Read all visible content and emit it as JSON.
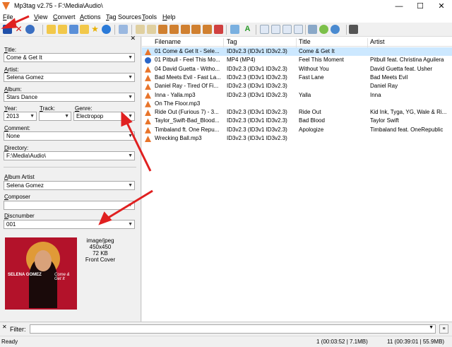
{
  "window": {
    "title": "Mp3tag v2.75  -  F:\\Media\\Audio\\",
    "minimize": "—",
    "maximize": "☐",
    "close": "✕"
  },
  "menu": [
    "File",
    "View",
    "Convert",
    "Actions",
    "Tag Sources",
    "Tools",
    "Help"
  ],
  "panel": {
    "close": "✕",
    "title_label": "Title:",
    "title_value": "Come & Get It",
    "artist_label": "Artist:",
    "artist_value": "Selena Gomez",
    "album_label": "Album:",
    "album_value": "Stars Dance",
    "year_label": "Year:",
    "year_value": "2013",
    "track_label": "Track:",
    "track_value": "",
    "genre_label": "Genre:",
    "genre_value": "Electropop",
    "comment_label": "Comment:",
    "comment_value": "None",
    "directory_label": "Directory:",
    "directory_value": "F:\\Media\\Audio\\",
    "albumartist_label": "Album Artist",
    "albumartist_value": "Selena Gomez",
    "composer_label": "Composer",
    "composer_value": "",
    "discnumber_label": "Discnumber",
    "discnumber_value": "001",
    "cover": {
      "type": "image/jpeg",
      "dims": "450x450",
      "size": "72 KB",
      "kind": "Front Cover",
      "text_left": "SELENA GOMEZ",
      "text_right": "Come & Get It"
    }
  },
  "grid": {
    "columns": [
      "Filename",
      "Tag",
      "Title",
      "Artist"
    ],
    "rows": [
      {
        "filename": "01 Come & Get It - Sele...",
        "tag": "ID3v2.3 (ID3v1 ID3v2.3)",
        "title": "Come & Get It",
        "artist": "",
        "icon": "vlc-icon"
      },
      {
        "filename": "01 Pitbull - Feel This Mo...",
        "tag": "MP4 (MP4)",
        "title": "Feel This Moment",
        "artist": "Pitbull feat. Christina Aguilera",
        "icon": "media-icon"
      },
      {
        "filename": "04 David Guetta - Witho...",
        "tag": "ID3v2.3 (ID3v1 ID3v2.3)",
        "title": "Without You",
        "artist": "David Guetta feat. Usher",
        "icon": "vlc-icon"
      },
      {
        "filename": "Bad Meets Evil - Fast La...",
        "tag": "ID3v2.3 (ID3v1 ID3v2.3)",
        "title": "Fast Lane",
        "artist": "Bad Meets Evil",
        "icon": "vlc-icon"
      },
      {
        "filename": "Daniel Ray - Tired Of Fi...",
        "tag": "ID3v2.3 (ID3v1 ID3v2.3)",
        "title": "",
        "artist": "Daniel Ray",
        "icon": "vlc-icon"
      },
      {
        "filename": "Inna - Yalla.mp3",
        "tag": "ID3v2.3 (ID3v1 ID3v2.3)",
        "title": "Yalla",
        "artist": "Inna",
        "icon": "vlc-icon"
      },
      {
        "filename": "On The Floor.mp3",
        "tag": "",
        "title": "",
        "artist": "",
        "icon": "vlc-icon"
      },
      {
        "filename": "Ride Out (Furious 7) - 3...",
        "tag": "ID3v2.3 (ID3v1 ID3v2.3)",
        "title": "Ride Out",
        "artist": "Kid Ink, Tyga, YG, Wale & Ri...",
        "icon": "vlc-icon"
      },
      {
        "filename": "Taylor_Swift-Bad_Blood...",
        "tag": "ID3v2.3 (ID3v1 ID3v2.3)",
        "title": "Bad Blood",
        "artist": "Taylor Swift",
        "icon": "vlc-icon"
      },
      {
        "filename": "Timbaland ft. One Repu...",
        "tag": "ID3v2.3 (ID3v1 ID3v2.3)",
        "title": "Apologize",
        "artist": "Timbaland feat. OneRepublic",
        "icon": "vlc-icon"
      },
      {
        "filename": "Wrecking Ball.mp3",
        "tag": "ID3v2.3 (ID3v1 ID3v2.3)",
        "title": "",
        "artist": "",
        "icon": "vlc-icon"
      }
    ]
  },
  "filter": {
    "label": "Filter:",
    "value": "",
    "button": "≡"
  },
  "status": {
    "left": "Ready",
    "selected": "1 (00:03:52 | 7.1MB)",
    "total": "11 (00:39:01 | 55.9MB)"
  },
  "colors": {
    "accent_red": "#e02020",
    "selection": "#cce8ff"
  }
}
